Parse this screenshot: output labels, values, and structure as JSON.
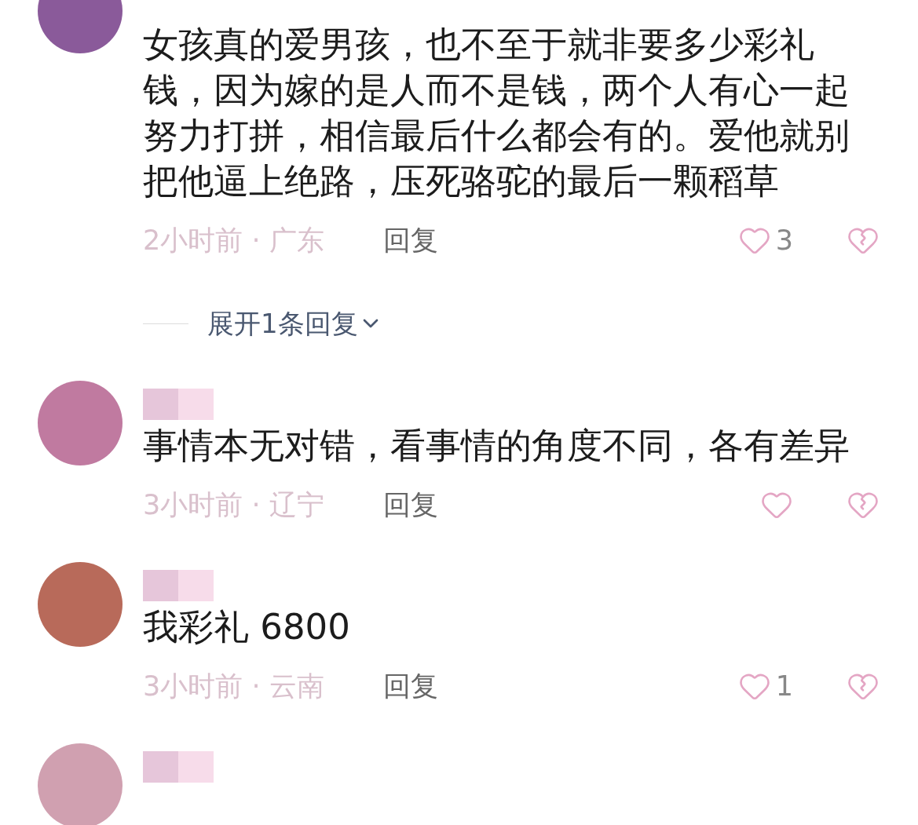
{
  "comments": [
    {
      "name_masked": false,
      "avatar_cut": true,
      "text": "女孩真的爱男孩，也不至于就非要多少彩礼钱，因为嫁的是人而不是钱，两个人有心一起努力打拼，相信最后什么都会有的。爱他就别把他逼上绝路，压死骆驼的最后一颗稻草",
      "meta": "2小时前 · 广东",
      "reply": "回复",
      "likes": "3",
      "expand": "展开1条回复"
    },
    {
      "name_masked": true,
      "avatar_cut": false,
      "text": "事情本无对错，看事情的角度不同，各有差异",
      "meta": "3小时前 · 辽宁",
      "reply": "回复"
    },
    {
      "name_masked": true,
      "avatar_cut": false,
      "text": "我彩礼 6800",
      "meta": "3小时前 · 云南",
      "reply": "回复",
      "likes": "1"
    },
    {
      "name_masked": true,
      "avatar_cut": false
    }
  ]
}
